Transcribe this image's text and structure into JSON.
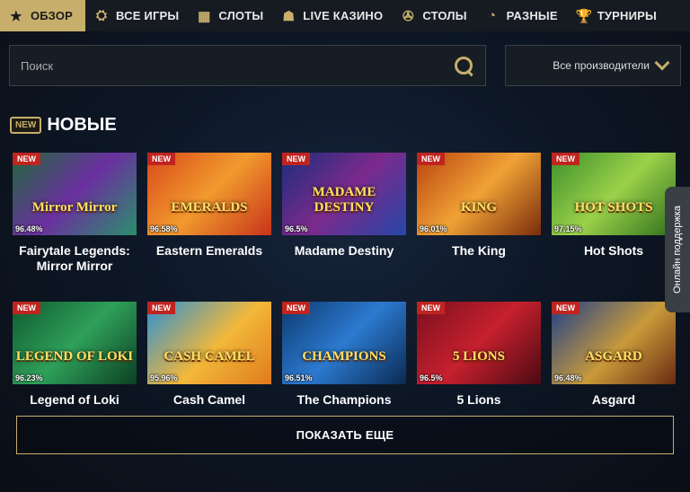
{
  "nav": {
    "items": [
      {
        "label": "ОБЗОР",
        "icon": "star-icon",
        "glyph": "★",
        "active": true
      },
      {
        "label": "ВСЕ ИГРЫ",
        "icon": "chip-icon",
        "glyph": "⛭",
        "active": false
      },
      {
        "label": "СЛОТЫ",
        "icon": "slot-machine-icon",
        "glyph": "▦",
        "active": false
      },
      {
        "label": "LIVE КАЗИНО",
        "icon": "dealer-icon",
        "glyph": "☗",
        "active": false
      },
      {
        "label": "СТОЛЫ",
        "icon": "roulette-icon",
        "glyph": "✇",
        "active": false
      },
      {
        "label": "РАЗНЫЕ",
        "icon": "dial-icon",
        "glyph": "◔",
        "active": false
      },
      {
        "label": "ТУРНИРЫ",
        "icon": "trophy-icon",
        "glyph": "🏆",
        "active": false
      }
    ]
  },
  "search": {
    "placeholder": "Поиск"
  },
  "providers": {
    "label": "Все производители"
  },
  "section": {
    "badge": "NEW",
    "title": "НОВЫЕ"
  },
  "games": [
    {
      "title": "Fairytale Legends: Mirror Mirror",
      "rtp": "96.48%",
      "ribbon": "NEW",
      "art": "Mirror Mirror",
      "bg": "linear-gradient(135deg,#1e6b3a,#6b2fa0 50%,#2a8f6a)"
    },
    {
      "title": "Eastern Emeralds",
      "rtp": "96.58%",
      "ribbon": "NEW",
      "art": "EMERALDS",
      "bg": "linear-gradient(135deg,#d8481b,#f29a2e 50%,#c7331a)"
    },
    {
      "title": "Madame Destiny",
      "rtp": "96.5%",
      "ribbon": "NEW",
      "art": "MADAME DESTINY",
      "bg": "linear-gradient(135deg,#1a2e7a,#7c2a8c 50%,#2547a8)"
    },
    {
      "title": "The King",
      "rtp": "96.01%",
      "ribbon": "NEW",
      "art": "KING",
      "bg": "linear-gradient(135deg,#b8420e,#f0a236 50%,#7a2c0c)"
    },
    {
      "title": "Hot Shots",
      "rtp": "97.15%",
      "ribbon": "NEW",
      "art": "HOT SHOTS",
      "bg": "linear-gradient(135deg,#3c8f2a,#9bd14a 50%,#2e6e1c)"
    },
    {
      "title": "Legend of Loki",
      "rtp": "96.23%",
      "ribbon": "NEW",
      "art": "LEGEND OF LOKI",
      "bg": "linear-gradient(135deg,#0f5a2e,#2fa05a 50%,#0b3f22)"
    },
    {
      "title": "Cash Camel",
      "rtp": "95.96%",
      "ribbon": "NEW",
      "art": "CASH CAMEL",
      "bg": "linear-gradient(135deg,#2a8fd6,#f2b83a 55%,#e07a1c)"
    },
    {
      "title": "The Champions",
      "rtp": "96.51%",
      "ribbon": "NEW",
      "art": "CHAMPIONS",
      "bg": "linear-gradient(135deg,#0d3a6e,#2c7ad0 50%,#0a2a52)"
    },
    {
      "title": "5 Lions",
      "rtp": "96.5%",
      "ribbon": "NEW",
      "art": "5 LIONS",
      "bg": "linear-gradient(135deg,#7a0f1e,#c7202e 50%,#4a0a12)"
    },
    {
      "title": "Asgard",
      "rtp": "96.48%",
      "ribbon": "NEW",
      "art": "ASGARD",
      "bg": "linear-gradient(135deg,#1e3f8a,#c89a3a 55%,#6a2a12)"
    }
  ],
  "more_button": {
    "label": "ПОКАЗАТЬ ЕЩЕ"
  },
  "support": {
    "label": "Онлайн поддержка"
  },
  "colors": {
    "accent": "#c7ae6b",
    "nav_bg": "#161b21",
    "ribbon": "#c0241f"
  }
}
